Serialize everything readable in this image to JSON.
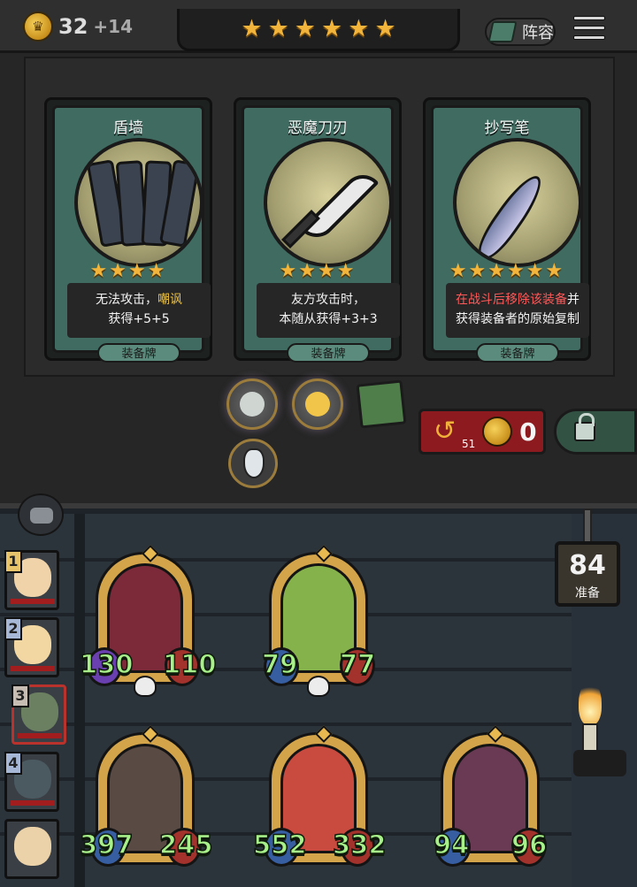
{
  "topbar": {
    "gold": "32",
    "gold_income": "+14",
    "tier_stars": "★★★★★★",
    "lineup_label": "阵容",
    "icons": {
      "gold": "coin-icon",
      "lineup": "book-icon",
      "menu": "menu-icon"
    }
  },
  "shop": {
    "cards": [
      {
        "name": "盾墙",
        "stars": "★★★★",
        "desc_line1_prefix": "无法攻击，",
        "desc_line1_highlight": "嘲讽",
        "desc_line2": "获得+5+5",
        "type": "装备牌"
      },
      {
        "name": "恶魔刀刃",
        "stars": "★★★★",
        "desc_line1": "友方攻击时，",
        "desc_line2": "本随从获得+3+3",
        "type": "装备牌"
      },
      {
        "name": "抄写笔",
        "stars": "★★★★★★",
        "desc_line1_red": "在战斗后移除该装备",
        "desc_line1_suffix": "并",
        "desc_line2": "获得装备者的原始复制",
        "type": "装备牌"
      }
    ],
    "refresh": {
      "count": "51",
      "cost": "0"
    },
    "colors": {
      "star": "#f2b43a",
      "highlight": "#f0c33f",
      "warning": "#ff5959",
      "refresh_bg": "#8c1a1f"
    }
  },
  "board": {
    "timer_value": "84",
    "timer_label": "准备",
    "players": [
      {
        "rank": "1"
      },
      {
        "rank": "2"
      },
      {
        "rank": "3"
      },
      {
        "rank": "4"
      },
      {
        "rank": ""
      }
    ],
    "minions": [
      {
        "attack": "130",
        "health": "110",
        "art": "#7c2a3a"
      },
      {
        "attack": "79",
        "health": "77",
        "art": "#86b24b"
      },
      {
        "attack": "397",
        "health": "245",
        "art": "#5a4a44"
      },
      {
        "attack": "552",
        "health": "332",
        "art": "#c94a3f"
      },
      {
        "attack": "94",
        "health": "96",
        "art": "#6a3a55"
      }
    ]
  }
}
